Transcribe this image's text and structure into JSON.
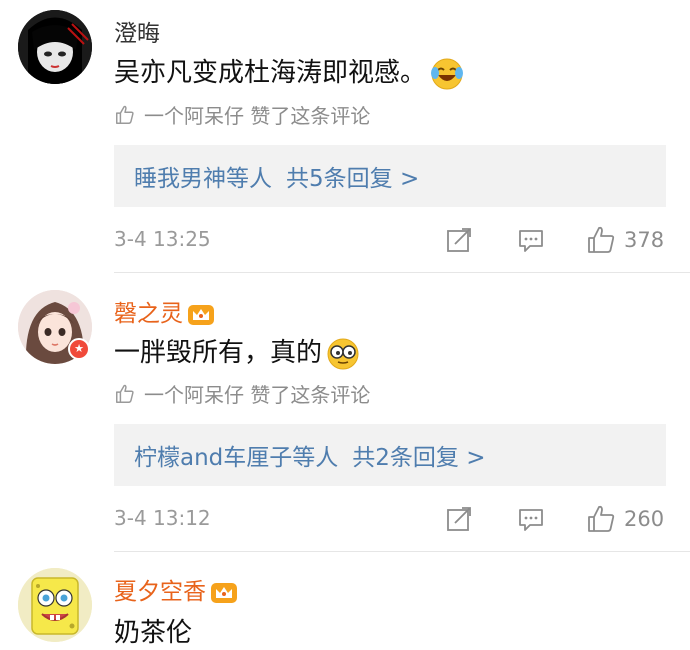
{
  "comments": [
    {
      "username": "澄晦",
      "text": "吴亦凡变成杜海涛即视感。",
      "emoji": "laughing-tears-emoji",
      "liked_by": "一个阿呆仔 赞了这条评论",
      "reply": {
        "names": "睡我男神等人",
        "count": "共5条回复 >"
      },
      "time": "3-4 13:25",
      "likes": "378"
    },
    {
      "username": "磬之灵",
      "vip": true,
      "text": "一胖毁所有，真的",
      "emoji": "sunglasses-emoji",
      "liked_by": "一个阿呆仔 赞了这条评论",
      "reply": {
        "names": "柠檬and车厘子等人",
        "count": "共2条回复 >"
      },
      "time": "3-4 13:12",
      "likes": "260"
    },
    {
      "username": "夏夕空香",
      "vip": true,
      "text": "奶茶伦"
    }
  ],
  "colors": {
    "link": "#4f7dae",
    "vip_name": "#e8631b",
    "meta": "#9a9a9a",
    "reply_bg": "#f2f2f2"
  },
  "icons": [
    "thumbs-up-icon",
    "share-icon",
    "comment-icon",
    "crown-icon",
    "verified-badge-icon"
  ]
}
